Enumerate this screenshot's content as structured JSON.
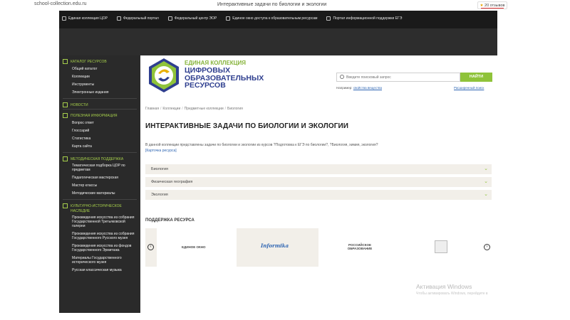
{
  "browser": {
    "url": "school-collection.edu.ru",
    "tab_title": "Интерактивные задачи по биологии и экологии",
    "reviews": "20 отзывов"
  },
  "portal_links": [
    {
      "label": "Единая коллекция ЦОР",
      "icon": "grid-icon"
    },
    {
      "label": "Федеральный портал",
      "icon": "pen-icon"
    },
    {
      "label": "Федеральный центр ЭОР",
      "icon": "book-icon"
    },
    {
      "label": "Единое окно доступа к образовательным ресурсам",
      "icon": "window-icon"
    },
    {
      "label": "Портал информационной поддержки ЕГЭ",
      "icon": "gear-icon"
    }
  ],
  "sidebar": {
    "sections": [
      {
        "title": "Каталог ресурсов",
        "icon": "catalog-icon",
        "items": [
          "Общий каталог",
          "Коллекции",
          "Инструменты",
          "Электронные издания"
        ]
      },
      {
        "title": "Новости",
        "icon": "news-icon",
        "items": []
      },
      {
        "title": "Полезная информация",
        "icon": "info-icon",
        "items": [
          "Вопрос ответ",
          "Глоссарий",
          "Статистика",
          "Карта сайта"
        ]
      },
      {
        "title": "Методическая поддержка",
        "icon": "methodic-icon",
        "items": [
          "Тематическая подборка ЦОР по предметам",
          "Педагогическая мастерская",
          "Мастер классы",
          "Методические материалы"
        ]
      },
      {
        "title": "Культурно-историческое наследие",
        "icon": "heritage-icon",
        "items": [
          "Произведения искусства из собрания Государственной Третьяковской галереи",
          "Произведения искусства из собрания Государственного Русского музея",
          "Произведения искусства из фондов Государственного Эрмитажа",
          "Материалы Государственного исторического музея",
          "Русская классическая музыка"
        ]
      }
    ]
  },
  "brand": {
    "small": "ЕДИНАЯ КОЛЛЕКЦИЯ",
    "line1": "ЦИФРОВЫХ",
    "line2": "ОБРАЗОВАТЕЛЬНЫХ",
    "line3": "РЕСУРСОВ"
  },
  "search": {
    "placeholder": "Введите поисковый запрос",
    "button": "НАЙТИ",
    "example_label": "Например:",
    "example_link": "свойства вещества",
    "advanced": "Расширенный поиск"
  },
  "breadcrumb": [
    "Главная",
    "Коллекции",
    "Предметные коллекции",
    "Биология"
  ],
  "page": {
    "title": "ИНТЕРАКТИВНЫЕ ЗАДАЧИ ПО БИОЛОГИИ И ЭКОЛОГИИ",
    "description": "В данной коллекции представлены задачи по биологии и экологии из курсов ?Подготовка к ЕГЭ по биологии?, ?Биология, химия, экология?",
    "card_link": "[Карточка ресурса]"
  },
  "accordion": [
    "Биология",
    "Физическая география",
    "Экология"
  ],
  "support": {
    "title": "ПОДДЕРЖКА РЕСУРСА",
    "partners": [
      "ЕДИНОЕ ОКНО",
      "Informika",
      "РОССИЙСКОЕ ОБРАЗОВАНИЕ"
    ],
    "prev": "‹",
    "next": "›"
  },
  "watermark": {
    "line1": "Активация Windows",
    "line2": "Чтобы активировать Windows, перейдите в"
  },
  "colors": {
    "accent_green": "#8fc33a",
    "brand_blue": "#2f3f8f",
    "dark_bg": "#2a2a2a"
  }
}
